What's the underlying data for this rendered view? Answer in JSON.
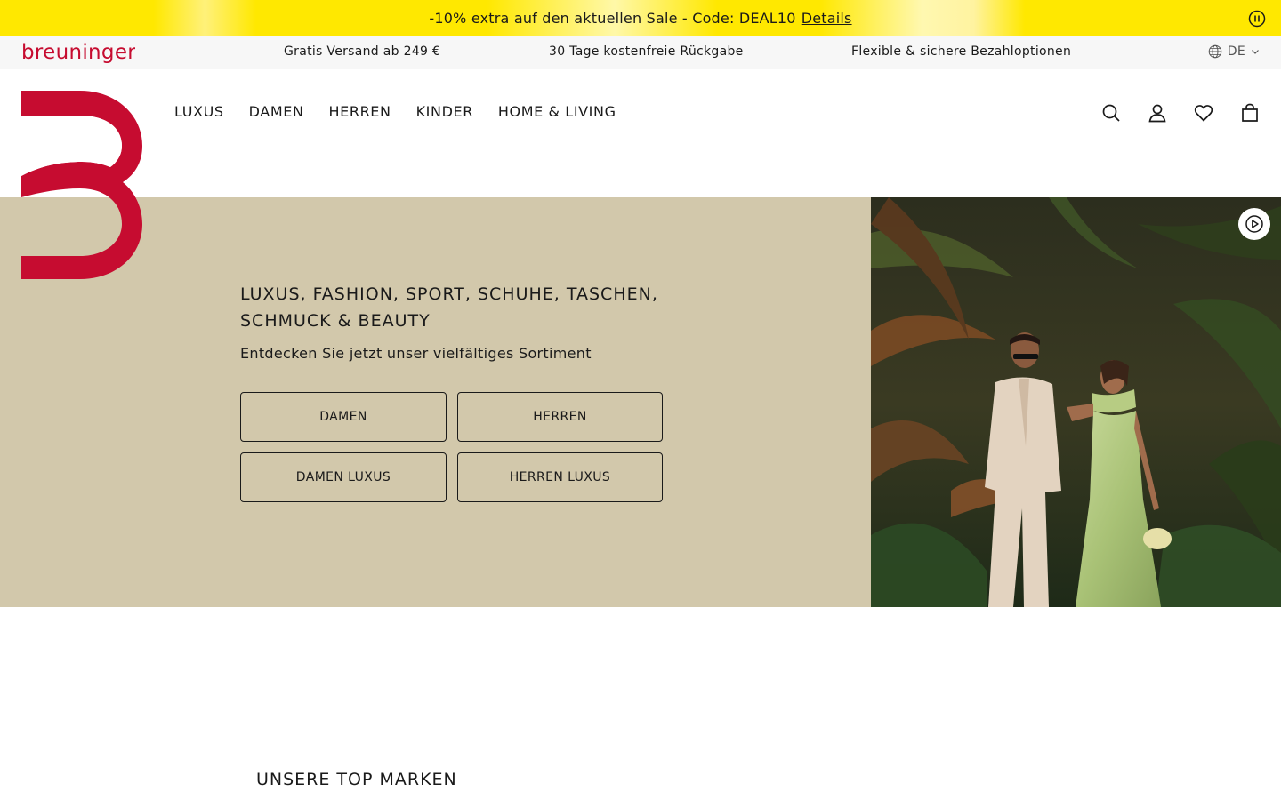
{
  "promo": {
    "text": "-10% extra auf den aktuellen Sale - Code: DEAL10",
    "link": "Details",
    "pause_icon": "pause-icon"
  },
  "usp": {
    "brand": "breuninger",
    "items": [
      "Gratis Versand ab 249 €",
      "30 Tage kostenfreie Rückgabe",
      "Flexible & sichere Bezahloptionen"
    ],
    "language": "DE"
  },
  "nav": {
    "items": [
      "LUXUS",
      "DAMEN",
      "HERREN",
      "KINDER",
      "HOME & LIVING"
    ]
  },
  "header_icons": [
    "search-icon",
    "user-icon",
    "heart-icon",
    "bag-icon"
  ],
  "hero": {
    "title": "LUXUS, FASHION, SPORT, SCHUHE, TASCHEN, SCHMUCK & BEAUTY",
    "subtitle": "Entdecken Sie jetzt unser vielfältiges Sortiment",
    "buttons": [
      "DAMEN",
      "HERREN",
      "DAMEN LUXUS",
      "HERREN LUXUS"
    ],
    "video_icon": "play-circle-icon"
  },
  "section": {
    "title": "UNSERE TOP MARKEN"
  },
  "colors": {
    "brand_red": "#c60c30",
    "promo_yellow": "#ffe800",
    "hero_beige": "#d2c8ab"
  }
}
